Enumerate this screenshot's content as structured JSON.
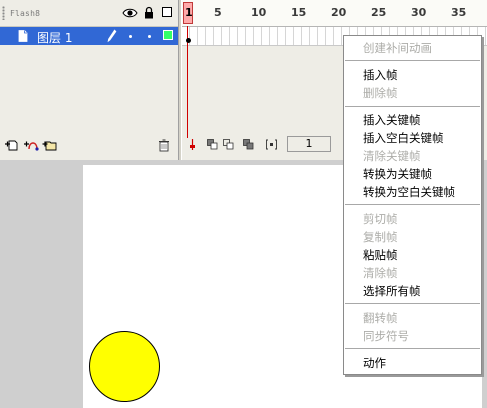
{
  "timeline": {
    "panel_title": "Flash8",
    "header_icons": [
      "eye-icon",
      "lock-icon",
      "outline-icon"
    ],
    "ruler_labels": [
      "1",
      "5",
      "10",
      "15",
      "20",
      "25",
      "30",
      "35"
    ],
    "current_frame": "1",
    "layers": [
      {
        "name": "图层 1",
        "selected": true,
        "color": "#33ff66"
      }
    ]
  },
  "context_menu": {
    "items": [
      {
        "label": "创建补间动画",
        "enabled": false
      },
      {
        "separator": true
      },
      {
        "label": "插入帧",
        "enabled": true
      },
      {
        "label": "删除帧",
        "enabled": false
      },
      {
        "separator": true
      },
      {
        "label": "插入关键帧",
        "enabled": true
      },
      {
        "label": "插入空白关键帧",
        "enabled": true
      },
      {
        "label": "清除关键帧",
        "enabled": false
      },
      {
        "label": "转换为关键帧",
        "enabled": true
      },
      {
        "label": "转换为空白关键帧",
        "enabled": true
      },
      {
        "separator": true
      },
      {
        "label": "剪切帧",
        "enabled": false
      },
      {
        "label": "复制帧",
        "enabled": false
      },
      {
        "label": "粘贴帧",
        "enabled": true
      },
      {
        "label": "清除帧",
        "enabled": false
      },
      {
        "label": "选择所有帧",
        "enabled": true
      },
      {
        "separator": true
      },
      {
        "label": "翻转帧",
        "enabled": false
      },
      {
        "label": "同步符号",
        "enabled": false
      },
      {
        "separator": true
      },
      {
        "label": "动作",
        "enabled": true
      }
    ]
  },
  "stage": {
    "shape": "circle",
    "fill": "#ffff00",
    "stroke": "#000000"
  },
  "colors": {
    "selection": "#3168d5",
    "playhead": "#d00000",
    "panel_bg": "#eeede6",
    "pasteboard": "#cfcfcf"
  }
}
